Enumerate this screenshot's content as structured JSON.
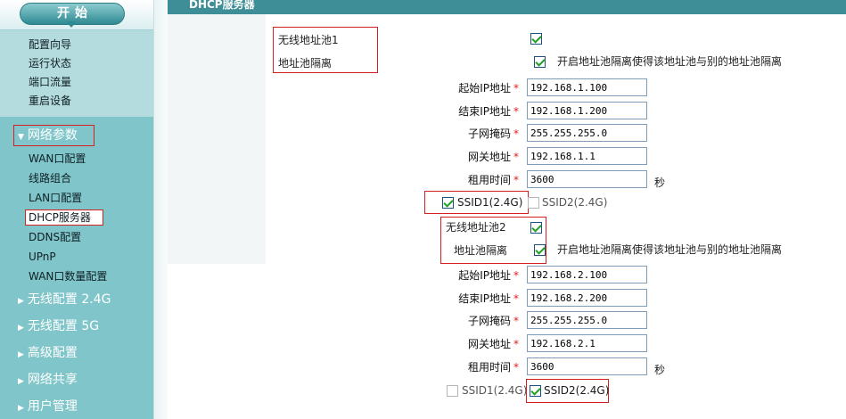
{
  "sidebar": {
    "start_label": "开始",
    "system_items": [
      "配置向导",
      "运行状态",
      "端口流量",
      "重启设备"
    ],
    "network_section": {
      "label": "网络参数",
      "items": [
        "WAN口配置",
        "线路组合",
        "LAN口配置",
        "DHCP服务器",
        "DDNS配置",
        "UPnP",
        "WAN口数量配置"
      ],
      "selected": "DHCP服务器"
    },
    "collapsed_sections": [
      "无线配置 2.4G",
      "无线配置 5G",
      "高级配置",
      "网络共享",
      "用户管理"
    ]
  },
  "titlebar": {
    "title": "DHCP服务器"
  },
  "pools": [
    {
      "pool_label": "无线地址池1",
      "pool_enabled": true,
      "isolation_label": "地址池隔离",
      "isolation_enabled": true,
      "isolation_hint": "开启地址池隔离使得该地址池与别的地址池隔离",
      "start_ip_label": "起始IP地址",
      "start_ip": "192.168.1.100",
      "end_ip_label": "结束IP地址",
      "end_ip": "192.168.1.200",
      "mask_label": "子网掩码",
      "mask": "255.255.255.0",
      "gateway_label": "网关地址",
      "gateway": "192.168.1.1",
      "lease_label": "租用时间",
      "lease": "3600",
      "lease_unit": "秒",
      "ssid1_label": "SSID1(2.4G)",
      "ssid1_checked": true,
      "ssid2_label": "SSID2(2.4G)",
      "ssid2_checked": false
    },
    {
      "pool_label": "无线地址池2",
      "pool_enabled": true,
      "isolation_label": "地址池隔离",
      "isolation_enabled": true,
      "isolation_hint": "开启地址池隔离使得该地址池与别的地址池隔离",
      "start_ip_label": "起始IP地址",
      "start_ip": "192.168.2.100",
      "end_ip_label": "结束IP地址",
      "end_ip": "192.168.2.200",
      "mask_label": "子网掩码",
      "mask": "255.255.255.0",
      "gateway_label": "网关地址",
      "gateway": "192.168.2.1",
      "lease_label": "租用时间",
      "lease": "3600",
      "lease_unit": "秒",
      "ssid1_label": "SSID1(2.4G)",
      "ssid1_checked": false,
      "ssid2_label": "SSID2(2.4G)",
      "ssid2_checked": true
    }
  ],
  "required_mark": "*",
  "colors": {
    "sidebar_bg": "#7fc5c9",
    "titlebar_bg": "#3d8e96",
    "highlight_border": "#d42020",
    "required_star": "#e02020"
  }
}
